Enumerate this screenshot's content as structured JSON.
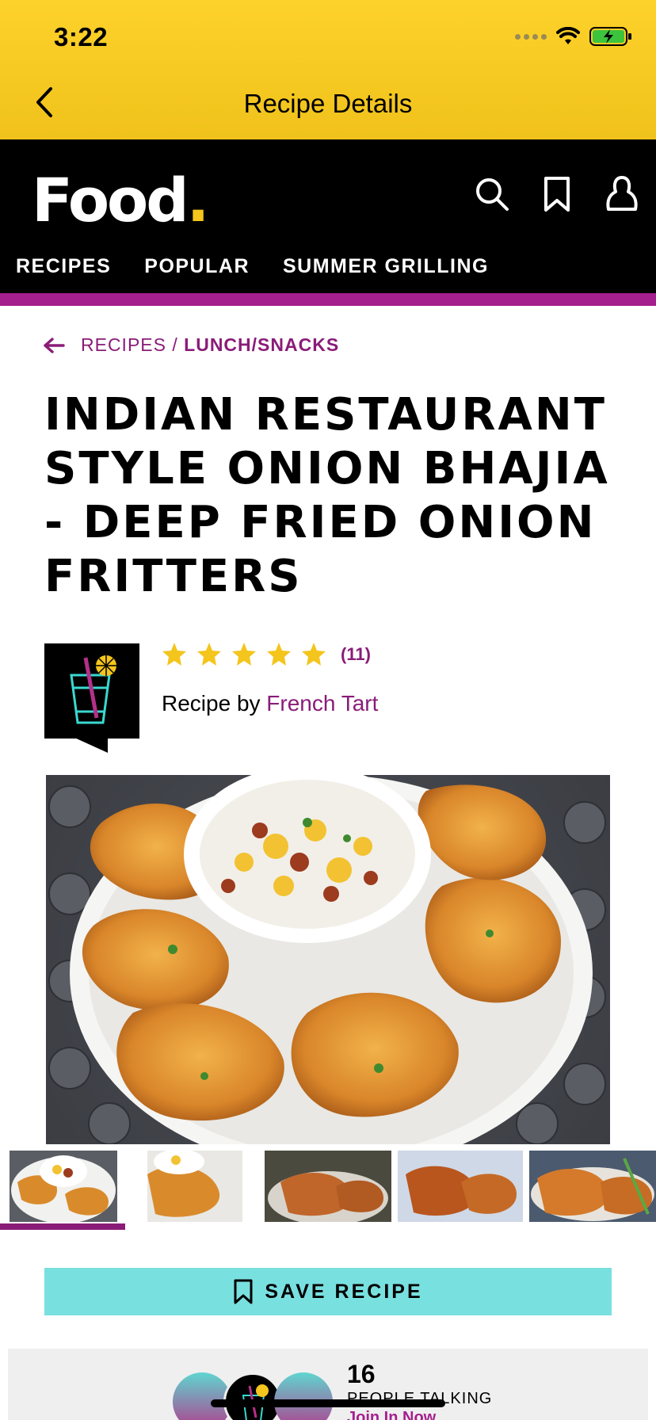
{
  "status": {
    "time": "3:22"
  },
  "nav": {
    "title": "Recipe Details"
  },
  "brand": {
    "logo_text": "Food",
    "logo_dot": ".",
    "logo_dot_color": "#f4c51c"
  },
  "tabs": [
    "RECIPES",
    "POPULAR",
    "SUMMER GRILLING"
  ],
  "breadcrumb": {
    "parent": "RECIPES",
    "separator": "/",
    "current": "LUNCH/SNACKS"
  },
  "recipe": {
    "title": "INDIAN RESTAURANT STYLE ONION BHAJIA - DEEP FRIED ONION FRITTERS",
    "rating": 5,
    "rating_count": "(11)",
    "by_label": "Recipe by",
    "author": "French Tart"
  },
  "gallery": {
    "thumb_count": 5,
    "selected_index": 0
  },
  "save": {
    "label": "SAVE RECIPE",
    "icon": "bookmark-icon"
  },
  "community": {
    "count": "16",
    "label": "PEOPLE TALKING",
    "cta": "Join In Now"
  },
  "colors": {
    "accent_yellow": "#f4c51c",
    "purple": "#a51f8e",
    "save_bg": "#79e0e0"
  }
}
